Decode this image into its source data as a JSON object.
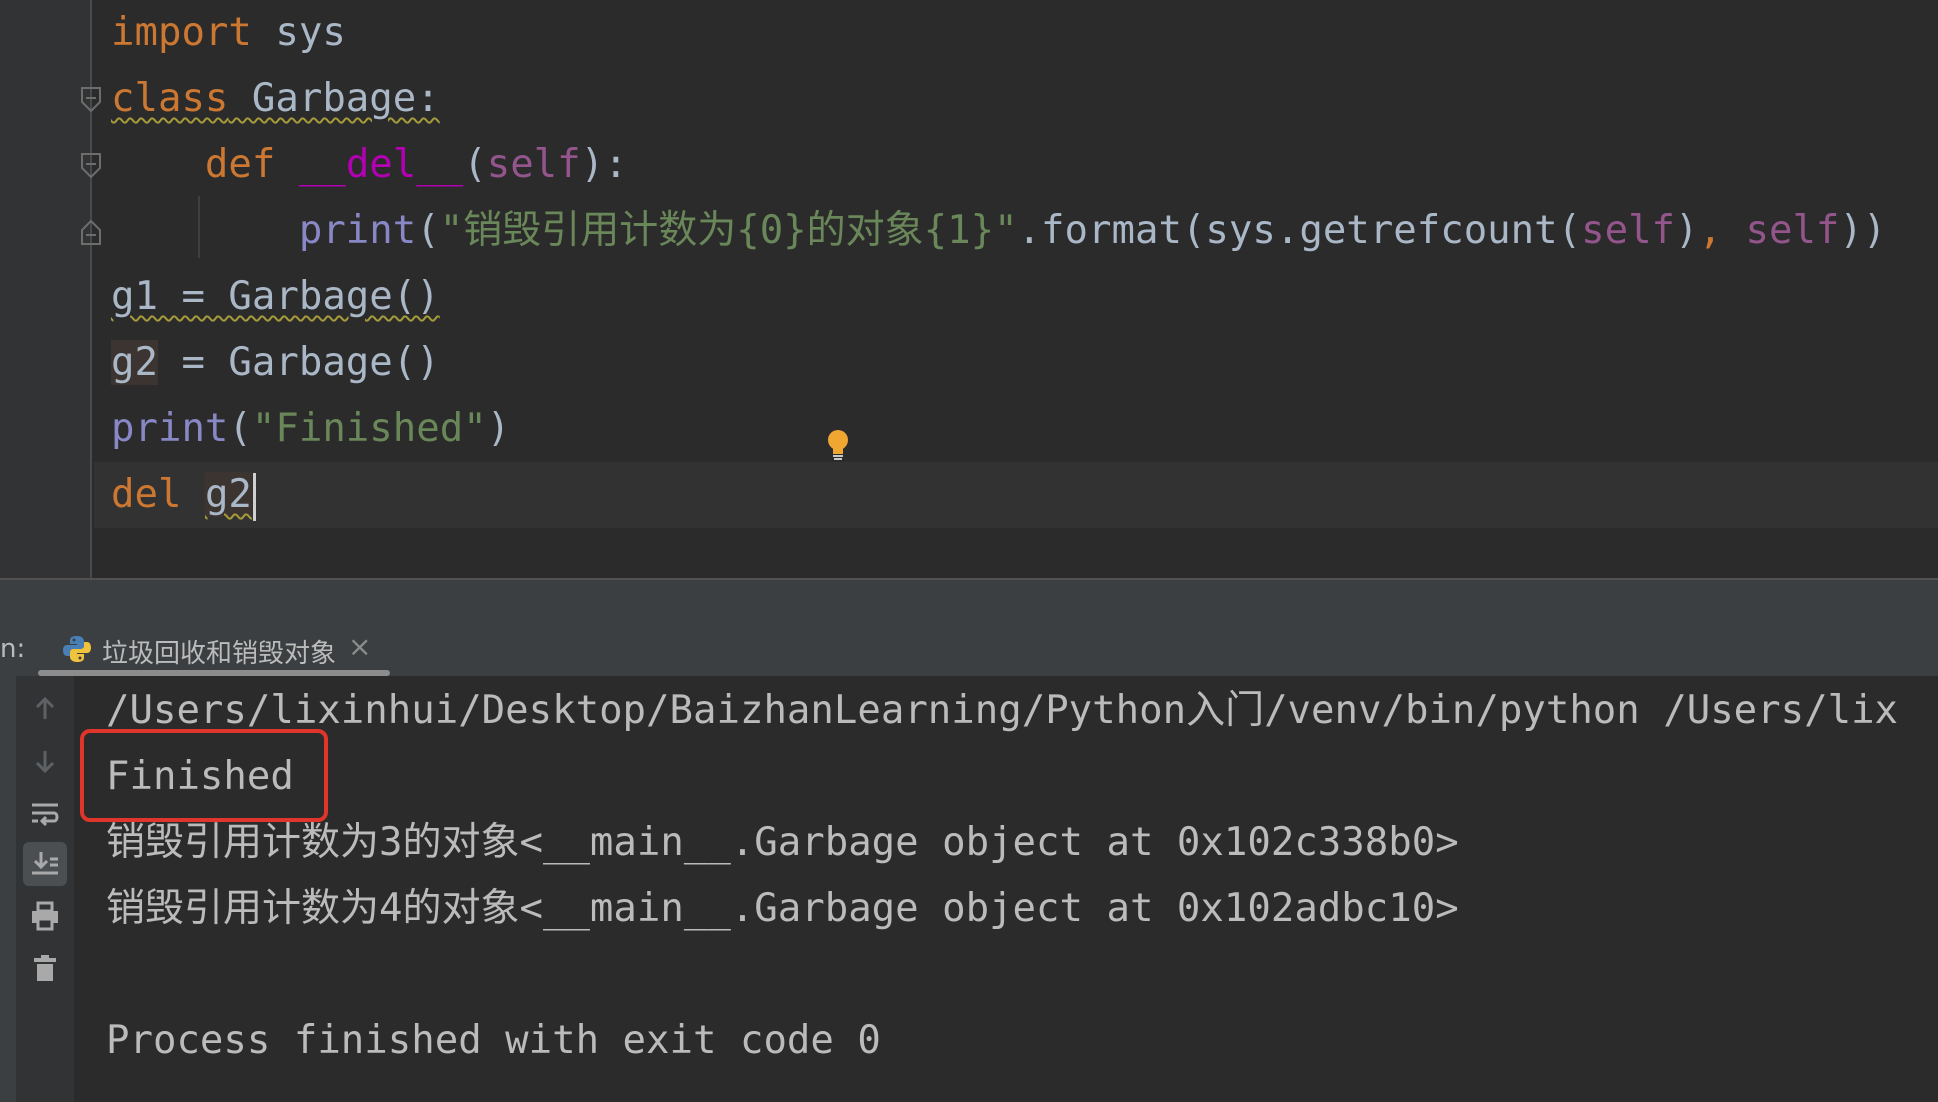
{
  "editor": {
    "lines": {
      "l1": {
        "kw": "import",
        "rest": " sys"
      },
      "l2": {
        "kw": "class",
        "name": " Garbage:"
      },
      "l3": {
        "indent": "    ",
        "kw": "def",
        "sp": " ",
        "magic": "__del__",
        "p1": "(",
        "self": "self",
        "p2": "):"
      },
      "l4": {
        "indent": "        ",
        "fn": "print",
        "p1": "(",
        "str": "\"销毁引用计数为{0}的对象{1}\"",
        "mid": ".format(sys.getrefcount(",
        "self1": "self",
        "p2": ")",
        "comma": ",",
        "sp": " ",
        "self2": "self",
        "p3": "))"
      },
      "l5": {
        "text": "g1 = Garbage()"
      },
      "l6": {
        "var": "g2",
        "rest": " = Garbage()"
      },
      "l7": {
        "fn": "print",
        "p1": "(",
        "str": "\"Finished\"",
        "p2": ")"
      },
      "l8": {
        "kw": "del",
        "sp": " ",
        "var": "g2"
      }
    }
  },
  "run": {
    "label": "n:",
    "tab_title": "垃圾回收和销毁对象",
    "tab_close": "×",
    "output": [
      "/Users/lixinhui/Desktop/BaizhanLearning/Python入门/venv/bin/python /Users/lix",
      "Finished",
      "销毁引用计数为3的对象<__main__.Garbage object at 0x102c338b0>",
      "销毁引用计数为4的对象<__main__.Garbage object at 0x102adbc10>",
      "",
      "Process finished with exit code 0"
    ]
  },
  "toolbar": {
    "icons": [
      "arrow-up-icon",
      "arrow-down-icon",
      "soft-wrap-icon",
      "scroll-to-end-icon",
      "print-icon",
      "trash-icon"
    ]
  },
  "colors": {
    "keyword": "#cc7832",
    "string": "#6a8759",
    "self": "#94558d",
    "magic": "#b200b2",
    "builtin": "#8888c6",
    "highlight": "#e0352a"
  }
}
